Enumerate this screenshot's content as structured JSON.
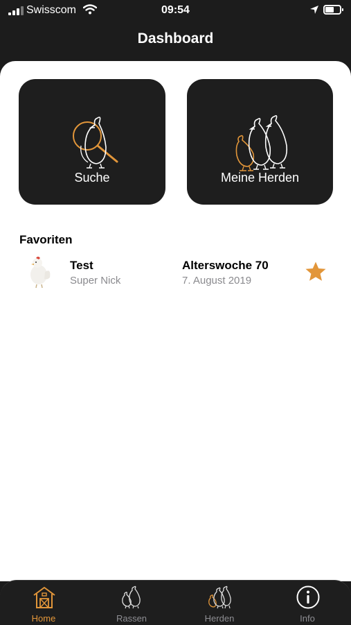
{
  "status_bar": {
    "carrier": "Swisscom",
    "time": "09:54"
  },
  "nav": {
    "title": "Dashboard"
  },
  "tiles": {
    "search_label": "Suche",
    "herds_label": "Meine Herden"
  },
  "favorites": {
    "title": "Favoriten",
    "items": [
      {
        "name": "Test",
        "breed": "Super Nick",
        "age": "Alterswoche 70",
        "date": "7. August 2019",
        "starred": true
      }
    ]
  },
  "tab_bar": {
    "tabs": [
      {
        "label": "Home",
        "icon": "barn-icon",
        "active": true
      },
      {
        "label": "Rassen",
        "icon": "chickens-icon",
        "active": false
      },
      {
        "label": "Herden",
        "icon": "herd-icon",
        "active": false
      },
      {
        "label": "Info",
        "icon": "info-icon",
        "active": false
      }
    ]
  },
  "colors": {
    "accent": "#e2963a",
    "dark": "#1e1e1e",
    "secondary_text": "#8a8a8e"
  }
}
